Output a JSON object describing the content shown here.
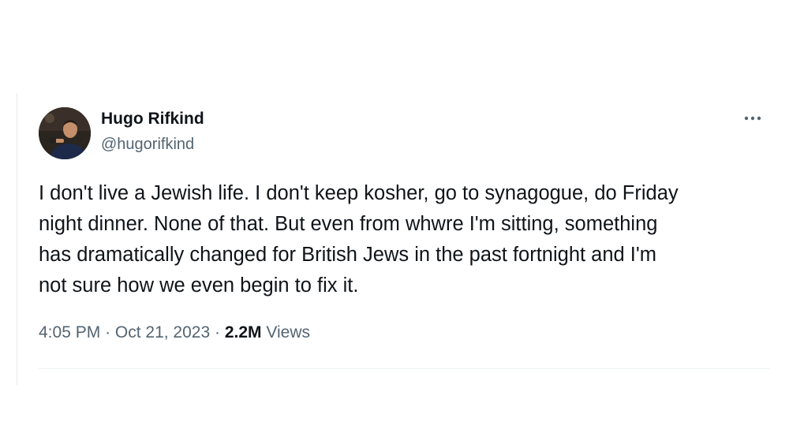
{
  "tweet": {
    "author": {
      "name": "Hugo Rifkind",
      "handle": "@hugorifkind",
      "avatar_icon": "user-photo"
    },
    "more_icon": "more-horizontal-icon",
    "text": "I don't live a Jewish life. I don't keep kosher, go to synagogue, do Friday\nnight dinner. None of that. But even from whwre I'm sitting, something\nhas dramatically changed for British Jews in the past fortnight and I'm\nnot sure how we even begin to fix it.",
    "time": "4:05 PM",
    "separator": "·",
    "date": "Oct 21, 2023",
    "views_count": "2.2M",
    "views_label": "Views"
  },
  "colors": {
    "text_primary": "#0f1419",
    "text_secondary": "#536471",
    "divider": "#eff3f4"
  }
}
